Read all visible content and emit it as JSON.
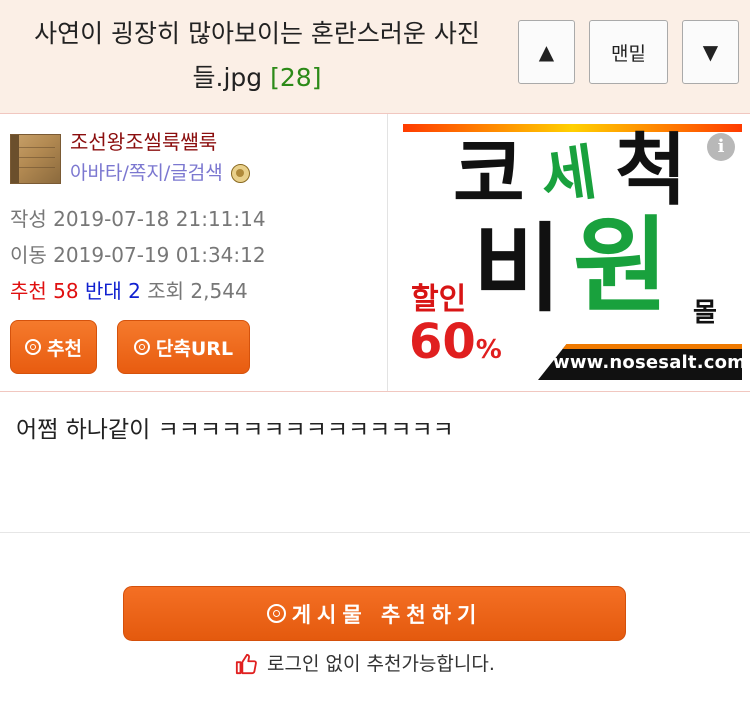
{
  "header": {
    "title_line1": "사연이 굉장히 많아보이는 혼란스러운 사진",
    "title_line2": "들.jpg",
    "comment_count": "[28]",
    "btn_up": "▲",
    "btn_bottom": "맨밑",
    "btn_down": "▼"
  },
  "author": {
    "nickname": "조선왕조씰룩쌜룩",
    "link_avatar": "아바타",
    "link_message": "쪽지",
    "link_search": "글검색",
    "sep": "/",
    "level_icon": "level-badge-icon"
  },
  "meta": {
    "written_label": "작성",
    "written_value": "2019-07-18 21:11:14",
    "moved_label": "이동",
    "moved_value": "2019-07-19 01:34:12",
    "rec_label": "추천",
    "rec_value": "58",
    "opp_label": "반대",
    "opp_value": "2",
    "view_label": "조회",
    "view_value": "2,544"
  },
  "buttons": {
    "recommend": "추천",
    "short_url": "단축URL",
    "post_recommend": "게시물 추천하기",
    "login_note": "로그인 없이 추천가능합니다."
  },
  "ad": {
    "word1": "코",
    "word2": "세",
    "word3": "척",
    "word4": "비",
    "word5": "원",
    "sale": "할인",
    "percent": "60",
    "percent_sign": "%",
    "mall": "몰",
    "url": "www.nosesalt.com",
    "info": "i"
  },
  "post": {
    "body": "어쩜 하나같이 ㅋㅋㅋㅋㅋㅋㅋㅋㅋㅋㅋㅋㅋㅋ"
  }
}
